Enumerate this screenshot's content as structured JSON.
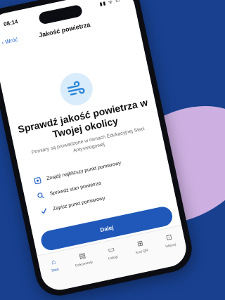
{
  "status": {
    "time": "08:14",
    "icons": "▮▮ ᯤ ▭"
  },
  "nav": {
    "back_label": "‹ Wróć",
    "title": "Jakość powietrza"
  },
  "hero": {
    "headline": "Sprawdź jakość powietrza w Twojej okolicy",
    "description": "Pomiary są prowadzone w ramach Edukacyjnej Sieci Antysmogowej."
  },
  "features": [
    {
      "icon": "map-pin-icon",
      "label": "Znajdź najbliższy punkt pomiarowy"
    },
    {
      "icon": "search-icon",
      "label": "Sprawdź stan powietrza"
    },
    {
      "icon": "check-icon",
      "label": "Zapisz punkt pomiarowy"
    }
  ],
  "cta": {
    "label": "Dalej"
  },
  "tabs": [
    {
      "label": "Start",
      "active": true
    },
    {
      "label": "Dokumenty",
      "active": false
    },
    {
      "label": "Usługi",
      "active": false
    },
    {
      "label": "Kod QR",
      "active": false
    },
    {
      "label": "Więcej",
      "active": false
    }
  ],
  "colors": {
    "background": "#18408f",
    "accent": "#1f58b8",
    "blob": "#d7b6e6"
  }
}
